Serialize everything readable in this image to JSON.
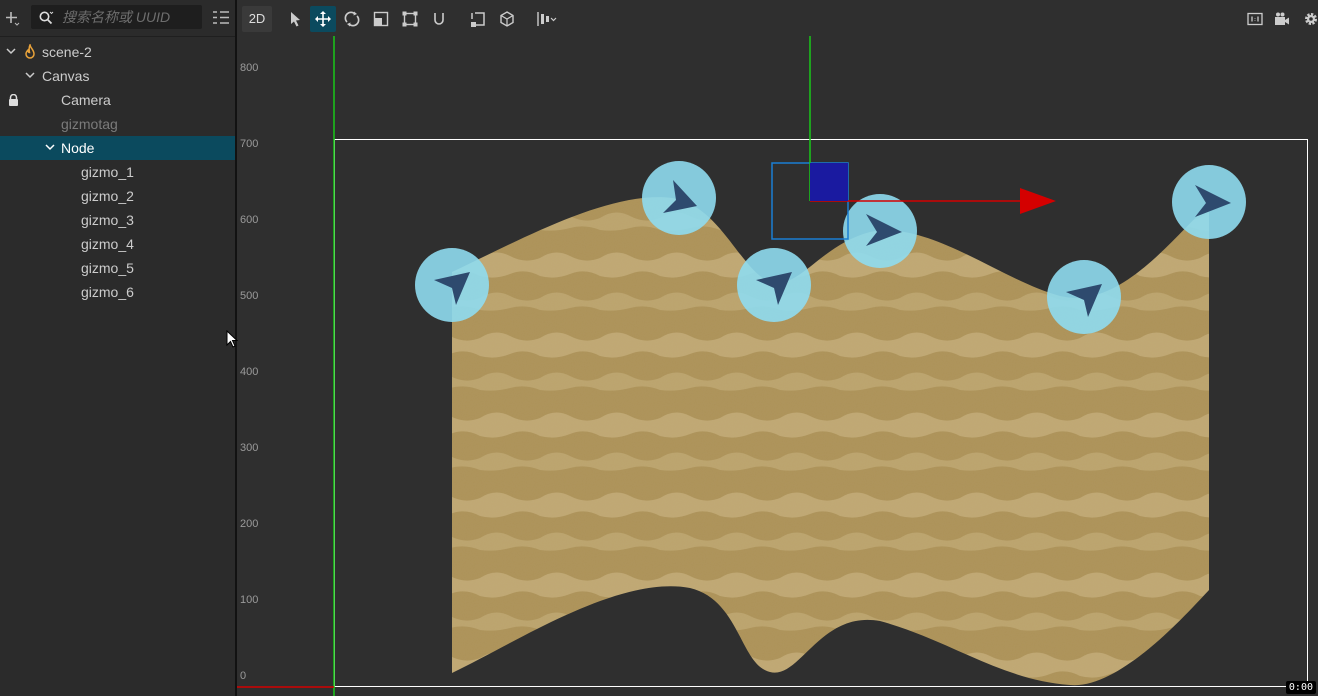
{
  "hierarchy": {
    "search_placeholder": "搜索名称或 UUID",
    "items": [
      {
        "label": "scene-2",
        "expanded": true,
        "icon": "fire-icon"
      },
      {
        "label": "Canvas",
        "expanded": true
      },
      {
        "label": "Camera",
        "locked": true,
        "icon": "lock-icon"
      },
      {
        "label": "gizmotag",
        "dimmed": true
      },
      {
        "label": "Node",
        "expanded": true,
        "selected": true
      },
      {
        "label": "gizmo_1"
      },
      {
        "label": "gizmo_2"
      },
      {
        "label": "gizmo_3"
      },
      {
        "label": "gizmo_4"
      },
      {
        "label": "gizmo_5"
      },
      {
        "label": "gizmo_6"
      }
    ]
  },
  "toolbar": {
    "mode_2d": "2D",
    "tools": [
      "select-icon",
      "move-icon",
      "rotate-icon",
      "scale-icon",
      "rect-icon",
      "snap-icon",
      "pivot-icon",
      "local-icon",
      "align-icon"
    ],
    "active_tool": "move-icon",
    "right_tools": [
      "aspect-icon",
      "camera-icon",
      "settings-icon"
    ]
  },
  "scene": {
    "ruler_labels": [
      "800",
      "700",
      "600",
      "500",
      "400",
      "300",
      "200",
      "100",
      "0"
    ],
    "time": "0:00",
    "colors": {
      "background": "#2f2f2f",
      "sand": "#c2aa72",
      "gizmo": "#8fdcef",
      "arrow": "#2e4a6e",
      "x_axis": "#d40000",
      "y_axis": "#19c919",
      "canvas_frame": "#ffffff",
      "selection": "#1a7fd4",
      "handle": "#1a1aa0"
    }
  }
}
